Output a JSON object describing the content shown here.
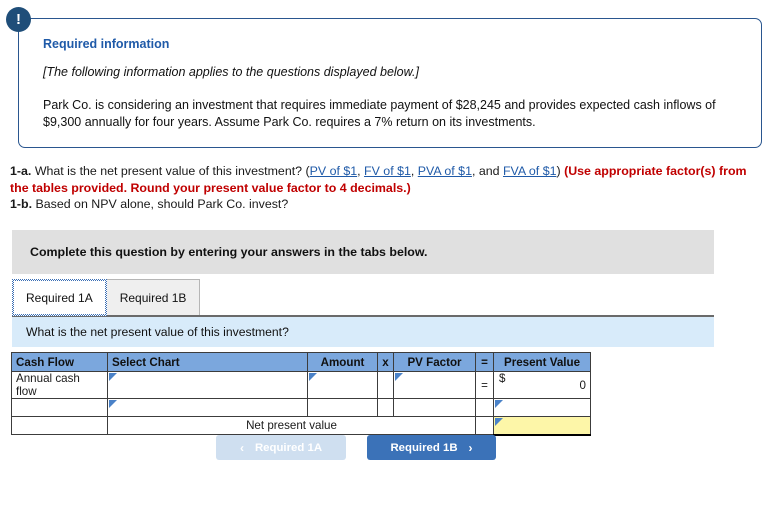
{
  "callout": {
    "icon": "exclamation-icon",
    "badge_glyph": "!",
    "title": "Required information",
    "applies_note": "[The following information applies to the questions displayed below.]",
    "body": "Park Co. is considering an investment that requires immediate payment of $28,245 and provides expected cash inflows of $9,300 annually for four years. Assume Park Co. requires a 7% return on its investments.",
    "border_color": "#2a568f",
    "title_color": "#1f5aa8",
    "badge_color": "#1f4e79"
  },
  "questions": {
    "q1a_num": "1-a.",
    "q1a_text": "What is the net present value of this investment? (",
    "links": [
      {
        "label": "PV of $1",
        "sep": ", "
      },
      {
        "label": "FV of $1",
        "sep": ", "
      },
      {
        "label": "PVA of $1",
        "sep": ", and "
      },
      {
        "label": "FVA of $1",
        "sep": ")"
      }
    ],
    "q1a_red": "(Use appropriate factor(s) from the tables provided. Round your present value factor to 4 decimals.)",
    "q1b_num": "1-b.",
    "q1b_text": "Based on NPV alone, should Park Co. invest?",
    "link_color": "#1f5aa8",
    "red_color": "#c00000"
  },
  "instruction_band": {
    "text": "Complete this question by entering your answers in the tabs below.",
    "background": "#e0e0e0"
  },
  "tabs": [
    {
      "label": "Required 1A",
      "active": true
    },
    {
      "label": "Required 1B",
      "active": false
    }
  ],
  "question_band": {
    "text": "What is the net present value of this investment?",
    "background": "#d8ebfa"
  },
  "worksheet": {
    "header_color": "#7ba7dd",
    "highlight_color": "#fdf6a8",
    "columns": [
      "Cash Flow",
      "Select Chart",
      "Amount",
      "x",
      "PV Factor",
      "=",
      "Present Value"
    ],
    "rows": [
      {
        "cash_flow": "Annual cash flow",
        "select_chart": "",
        "amount": "",
        "times": "",
        "pv_factor": "",
        "equals": "=",
        "present_value_symbol": "$",
        "present_value": "0"
      },
      {
        "cash_flow": "",
        "select_chart": "",
        "amount": "",
        "times": "",
        "pv_factor": "",
        "equals": "",
        "present_value_symbol": "",
        "present_value": ""
      }
    ],
    "total_row": {
      "label": "Net present value",
      "value": ""
    }
  },
  "nav": {
    "prev_label": "Required 1A",
    "prev_chevron": "‹",
    "next_label": "Required 1B",
    "next_chevron": "›",
    "prev_color": "#cfdff0",
    "next_color": "#3b72b8"
  }
}
